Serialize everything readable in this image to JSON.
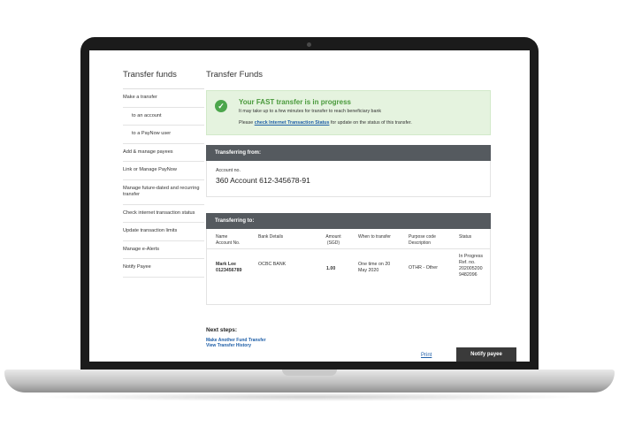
{
  "sidebar": {
    "title": "Transfer funds",
    "items": [
      {
        "label": "Make a transfer"
      },
      {
        "label": "to an account"
      },
      {
        "label": "to a PayNow user"
      },
      {
        "label": "Add & manage payees"
      },
      {
        "label": "Link or Manage PayNow"
      },
      {
        "label": "Manage future-dated and recurring transfer"
      },
      {
        "label": "Check internet transaction status"
      },
      {
        "label": "Update transaction limits"
      },
      {
        "label": "Manage e-Alerts"
      },
      {
        "label": "Notify Payee"
      }
    ]
  },
  "main": {
    "title": "Transfer Funds",
    "success": {
      "title": "Your FAST transfer is in progress",
      "line1": "It may take up to a few minutes for transfer to reach beneficiary bank",
      "line2_prefix": "Please",
      "line2_link": "check Internet Transaction Status",
      "line2_suffix": "for update on the status of this transfer."
    },
    "from": {
      "heading": "Transferring from:",
      "label": "Account no.",
      "value": "360 Account 612-345678-91"
    },
    "to": {
      "heading": "Transferring to:",
      "columns": [
        "Name",
        "Account No.",
        "Bank Details",
        "Amount",
        "(SGD)",
        "When to transfer",
        "Purpose code",
        "Description",
        "Status"
      ],
      "row": {
        "name": "Mark Lee",
        "account": "0123456789",
        "bank": "OCBC BANK",
        "amount": "1.00",
        "when": "One time on 20 May 2020",
        "purpose": "OTHR - Other",
        "status": "In Progress Ref. no. 202005200 9482096"
      }
    },
    "next_steps": {
      "title": "Next steps:",
      "links": [
        "Make Another Fund Transfer",
        "View Transfer History"
      ]
    },
    "actions": {
      "print": "Print",
      "notify": "Notify payee"
    }
  }
}
